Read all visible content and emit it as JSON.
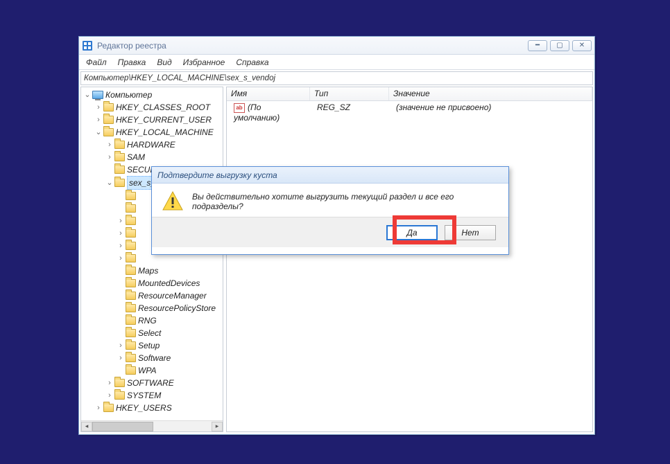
{
  "window": {
    "title": "Редактор реестра"
  },
  "menu": {
    "file": "Файл",
    "edit": "Правка",
    "view": "Вид",
    "favorites": "Избранное",
    "help": "Справка"
  },
  "path": "Компьютер\\HKEY_LOCAL_MACHINE\\sex_s_vendoj",
  "tree": {
    "root": "Компьютер",
    "hkcr": "HKEY_CLASSES_ROOT",
    "hkcu": "HKEY_CURRENT_USER",
    "hklm": "HKEY_LOCAL_MACHINE",
    "hardware": "HARDWARE",
    "sam": "SAM",
    "security": "SECURITY",
    "sexs": "sex_s_vendoj",
    "maps": "Maps",
    "mounted": "MountedDevices",
    "resmgr": "ResourceManager",
    "respol": "ResourcePolicyStore",
    "rng": "RNG",
    "select": "Select",
    "setup": "Setup",
    "software_sub": "Software",
    "wpa": "WPA",
    "software": "SOFTWARE",
    "system": "SYSTEM",
    "hku": "HKEY_USERS"
  },
  "list": {
    "col_name": "Имя",
    "col_type": "Тип",
    "col_value": "Значение",
    "row0_name": "(По умолчанию)",
    "row0_type": "REG_SZ",
    "row0_value": "(значение не присвоено)",
    "ab": "ab"
  },
  "dialog": {
    "title": "Подтвердите выгрузку куста",
    "message": "Вы действительно хотите выгрузить текущий раздел и все его подразделы?",
    "yes": "Да",
    "no": "Нет"
  }
}
